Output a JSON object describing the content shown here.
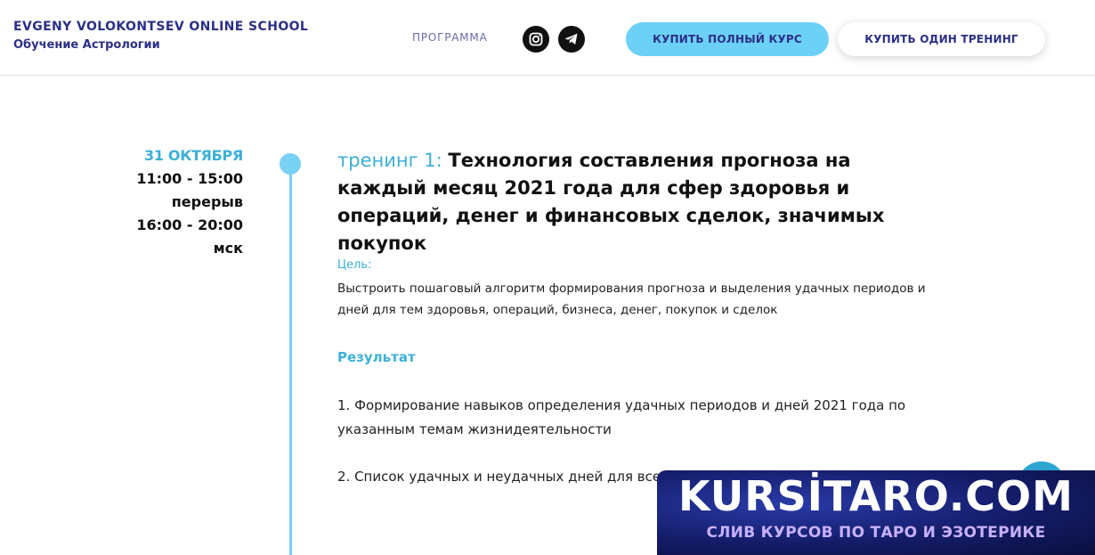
{
  "header": {
    "brand_name": "EVGENY VOLOKONTSEV ONLINE SCHOOL",
    "brand_sub": "Обучение Астрологии",
    "nav_program": "ПРОГРАММА",
    "social_icons": [
      "instagram-icon",
      "telegram-icon"
    ],
    "buy_full_label": "КУПИТЬ ПОЛНЫЙ КУРС",
    "buy_one_label": "КУПИТЬ ОДИН ТРЕНИНГ"
  },
  "schedule": {
    "date": "31 ОКТЯБРЯ",
    "time1": "11:00 - 15:00",
    "break_label": "перерыв",
    "time2": "16:00 - 20:00",
    "tz": "мск"
  },
  "training": {
    "prefix": "тренинг 1: ",
    "title": "Технология составления прогноза на каждый месяц 2021 года для сфер здоровья и операций, денег и финансовых сделок, значимых покупок",
    "goal_label": "Цель:",
    "goal_text": "Выстроить пошаговый алгоритм формирования прогноза и выделения удачных периодов и дней для тем здоровья, операций, бизнеса, денег, покупок и сделок",
    "result_heading": "Результат",
    "result_items": [
      "1. Формирование навыков определения удачных периодов и дней 2021 года по указанным темам жизнидеятельности",
      "2. Список удачных и неудачных дней для всех"
    ]
  },
  "watermark": {
    "title": "KURSİTARO.COM",
    "subtitle": "СЛИВ КУРСОВ ПО ТАРО И ЭЗОТЕРИКЕ"
  },
  "colors": {
    "brand": "#2b2f86",
    "accent": "#3db0d6",
    "button_full": "#6cd0f7",
    "timeline": "#79d1f4"
  }
}
